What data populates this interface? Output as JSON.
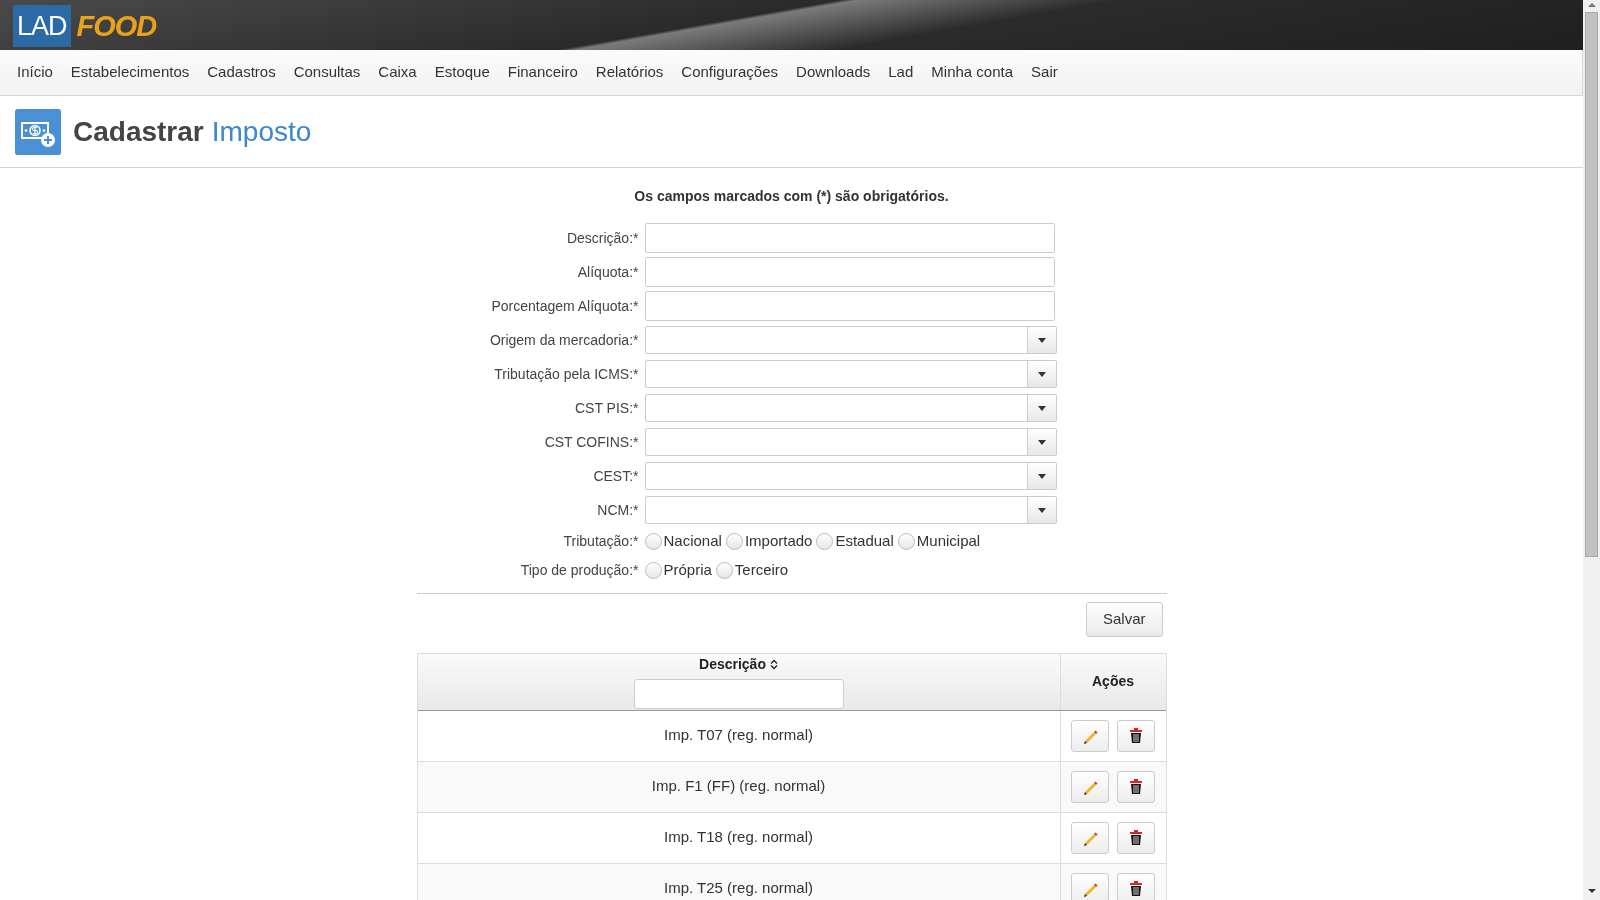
{
  "header": {
    "logo": {
      "left": "LAD",
      "right": "FOOD"
    }
  },
  "nav": {
    "items": [
      "Início",
      "Estabelecimentos",
      "Cadastros",
      "Consultas",
      "Caixa",
      "Estoque",
      "Financeiro",
      "Relatórios",
      "Configurações",
      "Downloads",
      "Lad",
      "Minha conta",
      "Sair"
    ]
  },
  "page_title": {
    "verb": "Cadastrar",
    "subject": "Imposto"
  },
  "form": {
    "required_note": "Os campos marcados com (*) são obrigatórios.",
    "fields": [
      {
        "label": "Descrição:*",
        "kind": "text"
      },
      {
        "label": "Alíquota:*",
        "kind": "text"
      },
      {
        "label": "Porcentagem Alíquota:*",
        "kind": "text"
      },
      {
        "label": "Origem da mercadoria:*",
        "kind": "select"
      },
      {
        "label": "Tributação pela ICMS:*",
        "kind": "select"
      },
      {
        "label": "CST PIS:*",
        "kind": "select"
      },
      {
        "label": "CST COFINS:*",
        "kind": "select"
      },
      {
        "label": "CEST:*",
        "kind": "select"
      },
      {
        "label": "NCM:*",
        "kind": "select"
      },
      {
        "label": "Tributação:*",
        "kind": "radio",
        "options": [
          {
            "label": "Nacional",
            "selected": false
          },
          {
            "label": "Importado",
            "selected": false
          },
          {
            "label": "Estadual",
            "selected": false
          },
          {
            "label": "Municipal",
            "selected": false
          }
        ]
      },
      {
        "label": "Tipo de produção:*",
        "kind": "radio",
        "options": [
          {
            "label": "Própria",
            "selected": false
          },
          {
            "label": "Terceiro",
            "selected": false
          }
        ]
      }
    ],
    "save_button": "Salvar"
  },
  "table": {
    "columns": [
      {
        "label": "Descrição",
        "sortable": true,
        "filter": true
      },
      {
        "label": "Ações",
        "sortable": false,
        "filter": false
      }
    ],
    "rows": [
      {
        "descricao": "Imp. T07 (reg. normal)"
      },
      {
        "descricao": "Imp. F1 (FF) (reg. normal)"
      },
      {
        "descricao": "Imp. T18 (reg. normal)"
      },
      {
        "descricao": "Imp. T25 (reg. normal)"
      }
    ]
  }
}
